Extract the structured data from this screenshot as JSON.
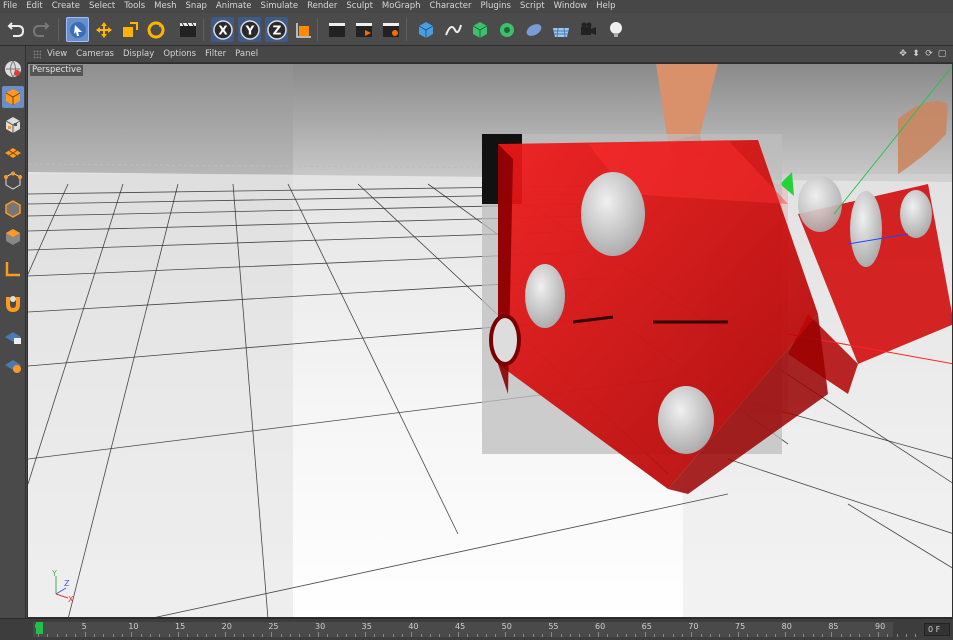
{
  "menu": [
    "File",
    "Edit",
    "Create",
    "Select",
    "Tools",
    "Mesh",
    "Snap",
    "Animate",
    "Simulate",
    "Render",
    "Sculpt",
    "MoGraph",
    "Character",
    "Plugins",
    "Script",
    "Window",
    "Help"
  ],
  "toolbar": {
    "buttons": [
      {
        "name": "undo-icon"
      },
      {
        "name": "redo-icon"
      },
      {
        "name": "live-selection-icon"
      },
      {
        "name": "move-icon"
      },
      {
        "name": "scale-icon"
      },
      {
        "name": "rotate-icon"
      },
      {
        "name": "recent-tools-icon"
      },
      {
        "name": "x-axis-icon",
        "label": "X"
      },
      {
        "name": "y-axis-icon",
        "label": "Y"
      },
      {
        "name": "z-axis-icon",
        "label": "Z"
      },
      {
        "name": "world-coordinate-icon"
      },
      {
        "name": "render-view-icon"
      },
      {
        "name": "render-picture-viewer-icon"
      },
      {
        "name": "render-settings-icon"
      },
      {
        "name": "cube-object-icon"
      },
      {
        "name": "spline-pen-icon"
      },
      {
        "name": "subdivision-icon"
      },
      {
        "name": "cloner-icon"
      },
      {
        "name": "deformer-icon"
      },
      {
        "name": "floor-icon"
      },
      {
        "name": "camera-icon"
      },
      {
        "name": "light-icon"
      }
    ]
  },
  "palette": [
    "model-mode-icon",
    "texture-mode-icon",
    "workplane-icon",
    "points-mode-icon",
    "edges-mode-icon",
    "polygons-mode-icon",
    "axis-mode-icon",
    "snap-magnet-icon",
    "locked-workplane-icon",
    "animation-mode-icon"
  ],
  "viewport_menu": [
    "View",
    "Cameras",
    "Display",
    "Options",
    "Filter",
    "Panel"
  ],
  "viewport": {
    "label": "Perspective",
    "axis_labels": [
      "Y",
      "Z",
      "X"
    ]
  },
  "timeline": {
    "ticks": [
      "0",
      "5",
      "10",
      "15",
      "20",
      "25",
      "30",
      "35",
      "40",
      "45",
      "50",
      "55",
      "60",
      "65",
      "70",
      "75",
      "80",
      "85",
      "90"
    ],
    "frame": "0 F"
  },
  "colors": {
    "accent": "#ffb400",
    "playhead": "#22c04a",
    "dice_red": "#e00000"
  }
}
